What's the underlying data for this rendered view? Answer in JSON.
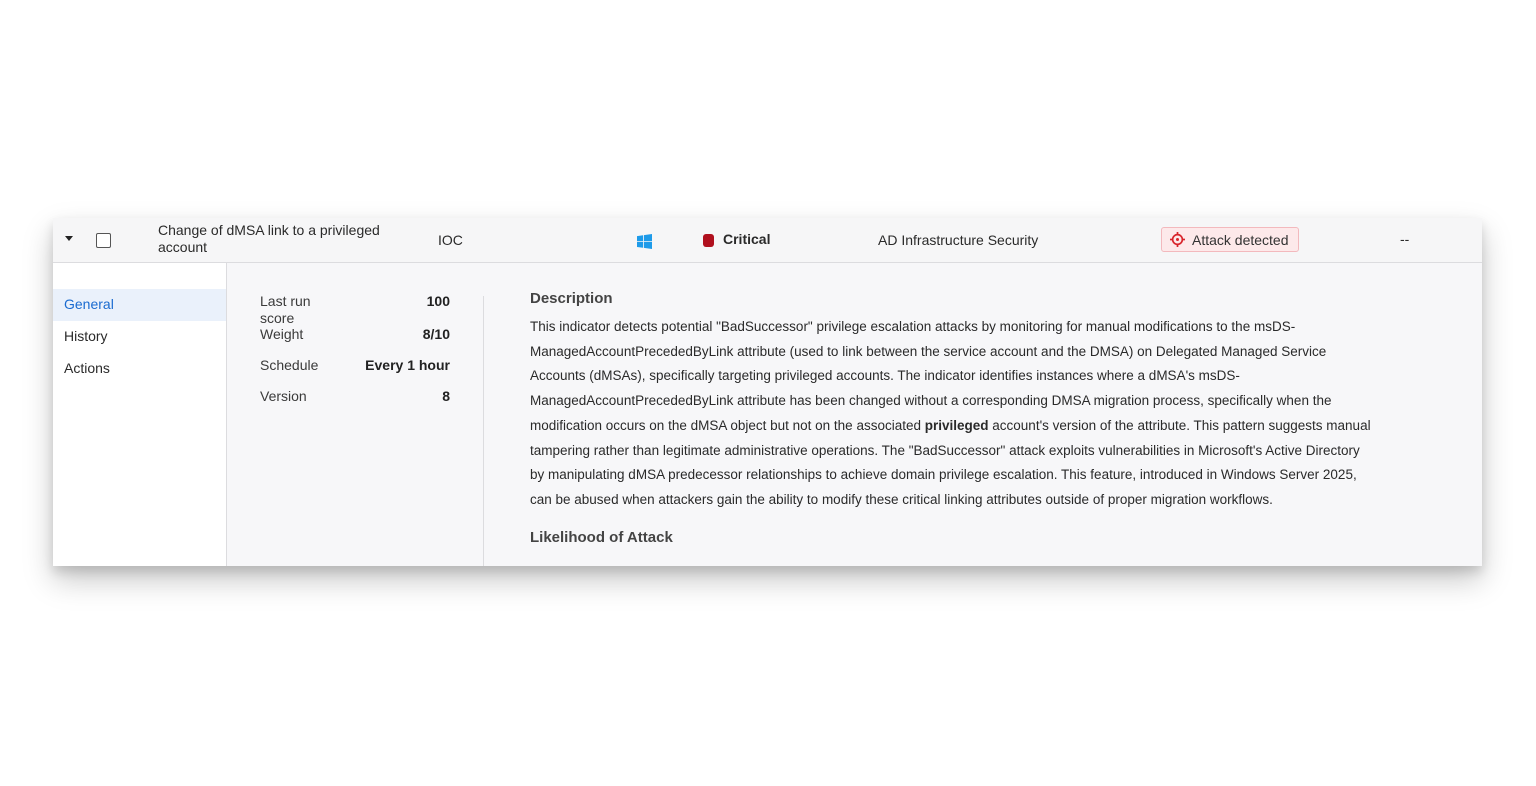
{
  "row": {
    "name": "Change of dMSA link to a privileged account",
    "type": "IOC",
    "os_icon": "windows-icon",
    "severity_label": "Critical",
    "severity_color": "#b0101e",
    "category": "AD Infrastructure Security",
    "status_label": "Attack detected",
    "status_icon": "crosshair-icon",
    "status_color": "#d8232a",
    "extra": "--"
  },
  "nav": {
    "items": [
      {
        "label": "General",
        "active": true
      },
      {
        "label": "History",
        "active": false
      },
      {
        "label": "Actions",
        "active": false
      }
    ]
  },
  "props": {
    "last_run_score_label": "Last run score",
    "last_run_score_value": "100",
    "weight_label": "Weight",
    "weight_value": "8/10",
    "schedule_label": "Schedule",
    "schedule_value": "Every 1 hour",
    "version_label": "Version",
    "version_value": "8"
  },
  "description": {
    "title": "Description",
    "text_before_bold": "This indicator detects potential \"BadSuccessor\" privilege escalation attacks by monitoring for manual modifications to the msDS-ManagedAccountPrecededByLink attribute (used to link between the service account and the DMSA) on Delegated Managed Service Accounts (dMSAs), specifically targeting privileged accounts. The indicator identifies instances where a dMSA's msDS-ManagedAccountPrecededByLink attribute has been changed without a corresponding DMSA migration process, specifically when the modification occurs on the dMSA object but not on the associated ",
    "bold_word": "privileged",
    "text_after_bold": " account's version of the attribute. This pattern suggests manual tampering rather than legitimate administrative operations. The \"BadSuccessor\" attack exploits vulnerabilities in Microsoft's Active Directory by manipulating dMSA predecessor relationships to achieve domain privilege escalation. This feature, introduced in Windows Server 2025, can be abused when attackers gain the ability to modify these critical linking attributes outside of proper migration workflows.",
    "next_heading": "Likelihood of Attack"
  }
}
